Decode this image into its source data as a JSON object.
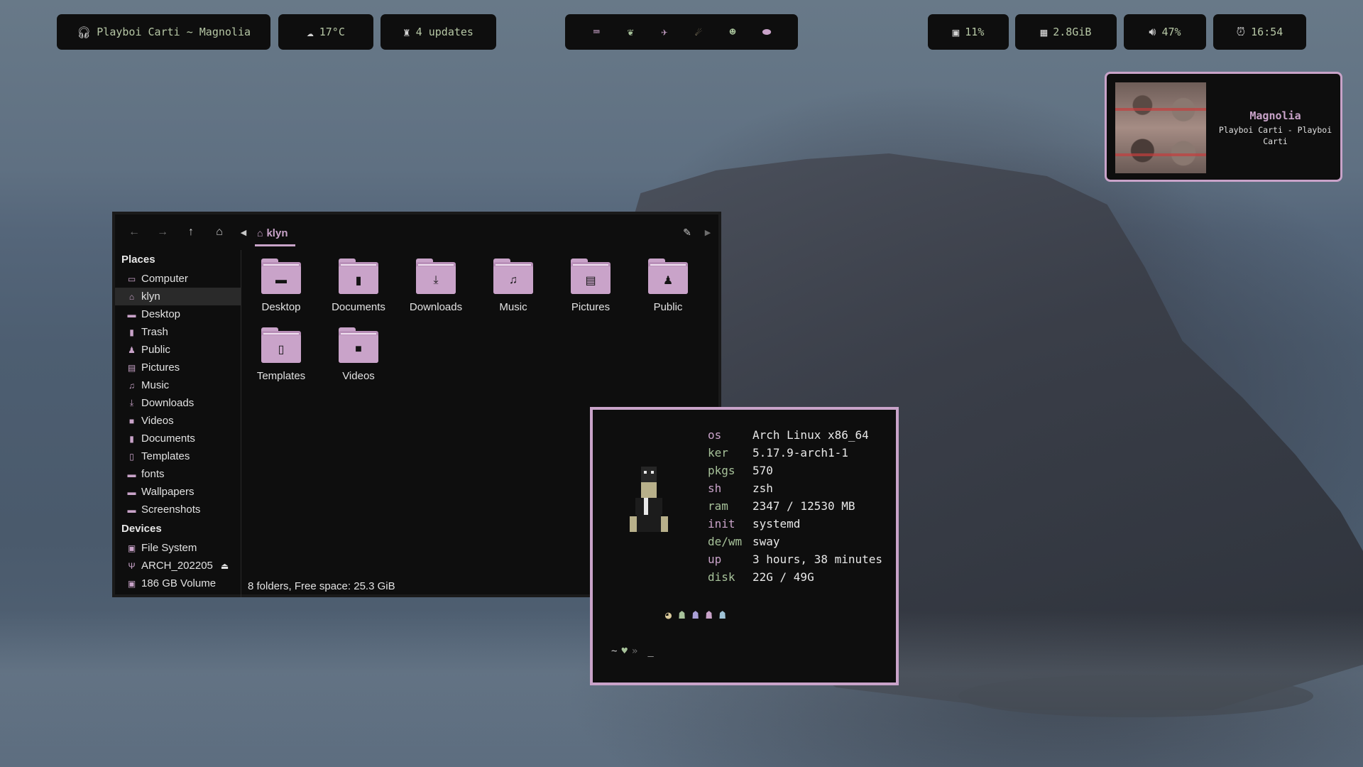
{
  "topbar": {
    "media": {
      "icon": "headphones-icon",
      "text": "Playboi Carti ~ Magnolia"
    },
    "weather": {
      "icon": "cloud-rain-icon",
      "text": "17°C"
    },
    "updates": {
      "icon": "ghost-icon",
      "text": "4 updates"
    },
    "apps": [
      {
        "name": "terminal-icon",
        "glyph": "⌨"
      },
      {
        "name": "leaf-icon",
        "glyph": "❦"
      },
      {
        "name": "telescope-icon",
        "glyph": "✈"
      },
      {
        "name": "meteor-icon",
        "glyph": "☄"
      },
      {
        "name": "alien-icon",
        "glyph": "☻"
      },
      {
        "name": "ufo-icon",
        "glyph": "⬬"
      }
    ],
    "cpu": {
      "icon": "cpu-icon",
      "text": "11%"
    },
    "memory": {
      "icon": "memory-icon",
      "text": "2.8GiB"
    },
    "volume": {
      "icon": "volume-icon",
      "text": "47%"
    },
    "clock": {
      "icon": "alarm-clock-icon",
      "text": "16:54"
    }
  },
  "media_card": {
    "title": "Magnolia",
    "subtitle": "Playboi Carti - Playboi Carti"
  },
  "file_manager": {
    "breadcrumb": "klyn",
    "places_header": "Places",
    "devices_header": "Devices",
    "places": [
      {
        "label": "Computer",
        "icon": "computer-icon"
      },
      {
        "label": "klyn",
        "icon": "home-icon",
        "active": true
      },
      {
        "label": "Desktop",
        "icon": "desktop-folder-icon"
      },
      {
        "label": "Trash",
        "icon": "trash-icon"
      },
      {
        "label": "Public",
        "icon": "users-icon"
      },
      {
        "label": "Pictures",
        "icon": "pictures-icon"
      },
      {
        "label": "Music",
        "icon": "music-icon"
      },
      {
        "label": "Downloads",
        "icon": "download-icon"
      },
      {
        "label": "Videos",
        "icon": "video-icon"
      },
      {
        "label": "Documents",
        "icon": "document-icon"
      },
      {
        "label": "Templates",
        "icon": "template-icon"
      },
      {
        "label": "fonts",
        "icon": "folder-icon"
      },
      {
        "label": "Wallpapers",
        "icon": "folder-icon"
      },
      {
        "label": "Screenshots",
        "icon": "folder-icon"
      }
    ],
    "devices": [
      {
        "label": "File System",
        "icon": "drive-icon"
      },
      {
        "label": "ARCH_202205",
        "icon": "usb-icon",
        "ejectable": true
      },
      {
        "label": "186 GB Volume",
        "icon": "drive-icon"
      }
    ],
    "folders": [
      {
        "label": "Desktop",
        "icon": "desktop-icon"
      },
      {
        "label": "Documents",
        "icon": "document-icon"
      },
      {
        "label": "Downloads",
        "icon": "download-icon"
      },
      {
        "label": "Music",
        "icon": "music-icon"
      },
      {
        "label": "Pictures",
        "icon": "image-icon"
      },
      {
        "label": "Public",
        "icon": "user-icon"
      },
      {
        "label": "Templates",
        "icon": "template-icon"
      },
      {
        "label": "Videos",
        "icon": "video-icon"
      }
    ],
    "status": "8 folders, Free space: 25.3 GiB"
  },
  "terminal": {
    "fetch": [
      {
        "key": "os",
        "value": "Arch Linux x86_64"
      },
      {
        "key": "ker",
        "value": "5.17.9-arch1-1"
      },
      {
        "key": "pkgs",
        "value": "570"
      },
      {
        "key": "sh",
        "value": "zsh"
      },
      {
        "key": "ram",
        "value": "2347 / 12530 MB"
      },
      {
        "key": "init",
        "value": "systemd"
      },
      {
        "key": "de/wm",
        "value": "sway"
      },
      {
        "key": "up",
        "value": "3 hours, 38 minutes"
      },
      {
        "key": "disk",
        "value": "22G / 49G"
      }
    ],
    "prompt": {
      "tilde": "~",
      "heart": "♥",
      "chevrons": "»",
      "cursor": "_"
    }
  },
  "colors": {
    "accent": "#c9a3c9",
    "green": "#a7c29a",
    "bar_bg": "#0e0e0e"
  }
}
